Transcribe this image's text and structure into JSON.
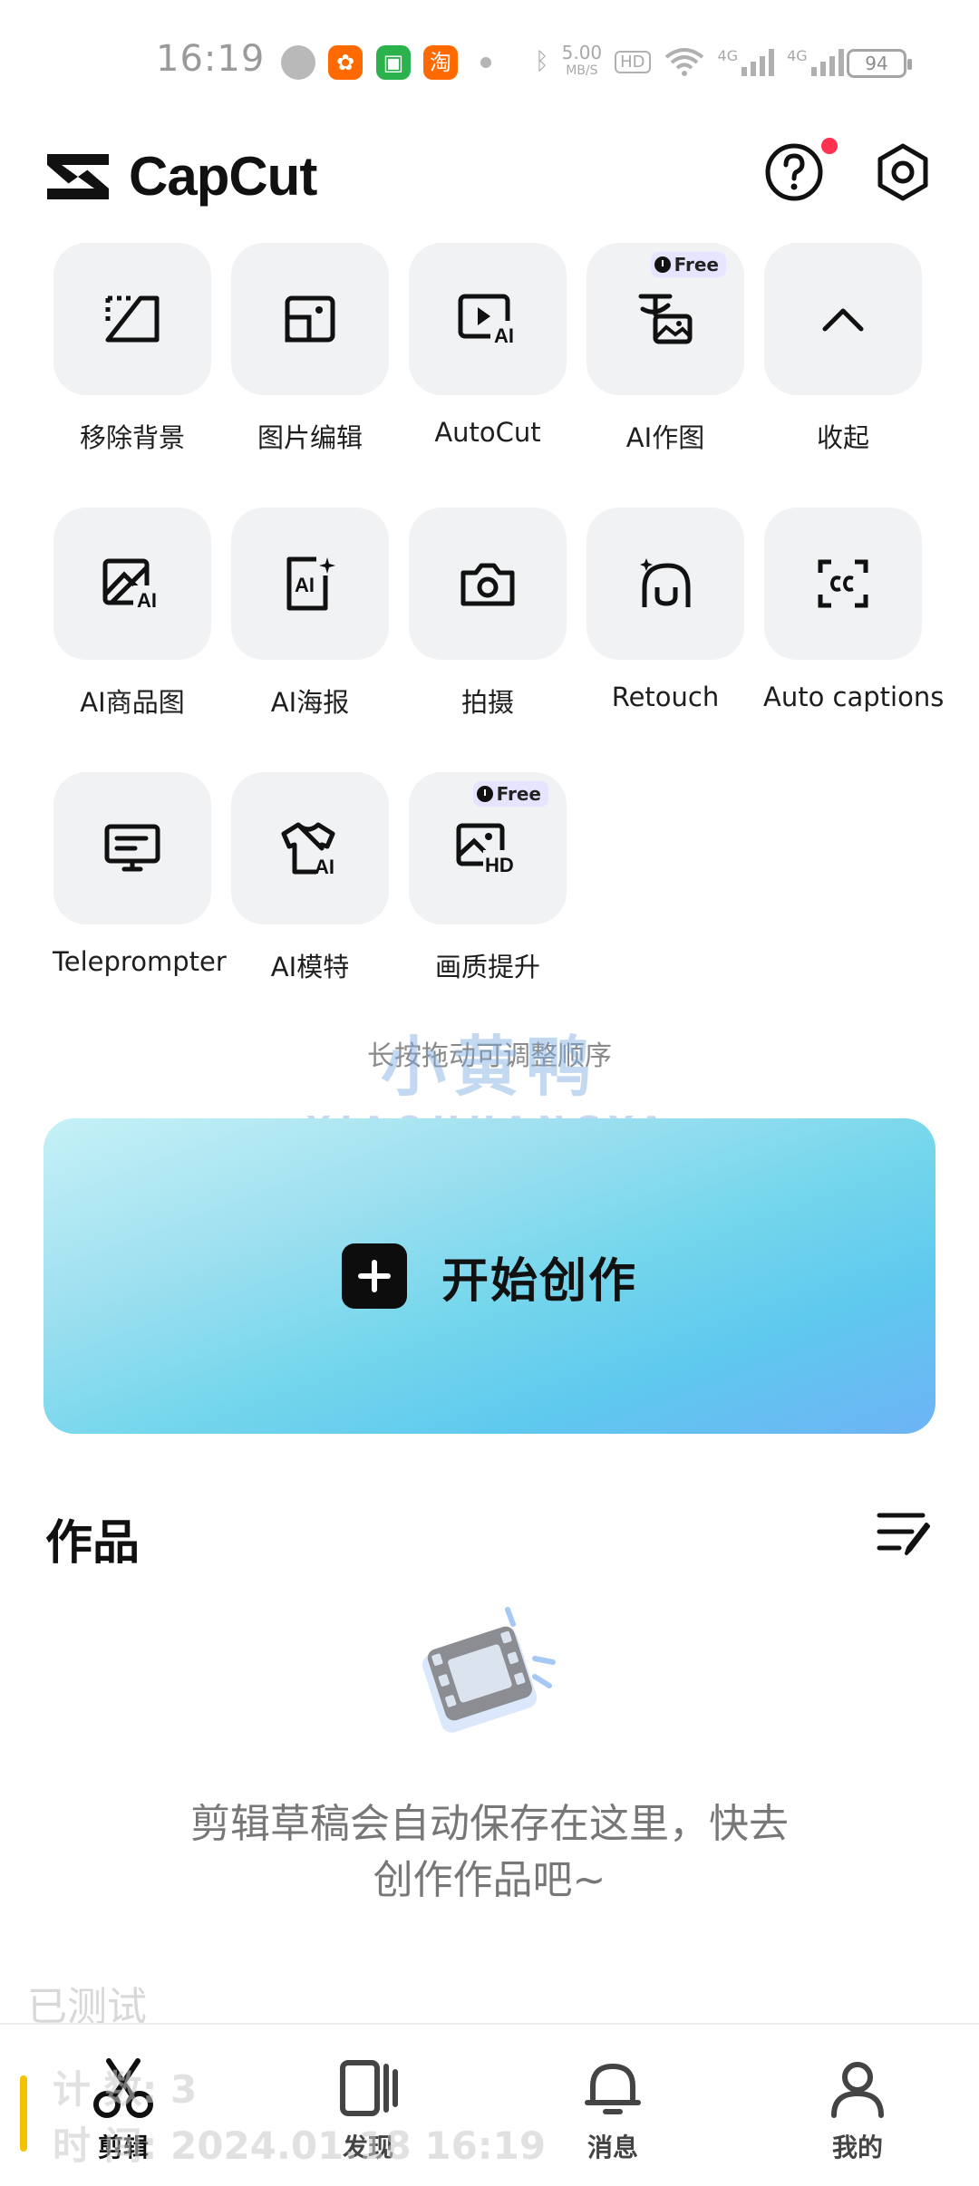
{
  "status_bar": {
    "time": "16:19",
    "network_speed_value": "5.00",
    "network_speed_unit": "MB/S",
    "hd_badge": "HD",
    "signal_1": "4G",
    "signal_2": "4G",
    "battery": "94"
  },
  "header": {
    "app_name": "CapCut",
    "help_icon": "help-circle-icon",
    "settings_icon": "settings-hexagon-icon",
    "help_has_notification": true
  },
  "tools": [
    {
      "label": "移除背景",
      "icon": "remove-background-icon",
      "free": false
    },
    {
      "label": "图片编辑",
      "icon": "photo-edit-icon",
      "free": false
    },
    {
      "label": "AutoCut",
      "icon": "autocut-icon",
      "free": false
    },
    {
      "label": "AI作图",
      "icon": "ai-image-icon",
      "free": true
    },
    {
      "label": "收起",
      "icon": "chevron-up-icon",
      "free": false
    },
    {
      "label": "AI商品图",
      "icon": "ai-product-icon",
      "free": false
    },
    {
      "label": "AI海报",
      "icon": "ai-poster-icon",
      "free": false
    },
    {
      "label": "拍摄",
      "icon": "camera-icon",
      "free": false
    },
    {
      "label": "Retouch",
      "icon": "retouch-icon",
      "free": false
    },
    {
      "label": "Auto captions",
      "icon": "captions-icon",
      "free": false
    },
    {
      "label": "Teleprompter",
      "icon": "teleprompter-icon",
      "free": false
    },
    {
      "label": "AI模特",
      "icon": "ai-model-shirt-icon",
      "free": false
    },
    {
      "label": "画质提升",
      "icon": "hd-enhance-icon",
      "free": true
    }
  ],
  "free_badge": "Free",
  "drag_hint": "长按拖动可调整顺序",
  "watermark": {
    "cn": "小黄鸭",
    "en": "XIAOHUANGYA"
  },
  "create_button": {
    "label": "开始创作"
  },
  "works": {
    "title": "作品",
    "empty_text_line1": "剪辑草稿会自动保存在这里，快去",
    "empty_text_line2": "创作作品吧~"
  },
  "overlay": {
    "tested": "已测试",
    "count": "计 数: 3",
    "time": "时 间: 2024.01.18 16:19"
  },
  "bottom_nav": [
    {
      "label": "剪辑",
      "icon": "scissors-icon",
      "active": true
    },
    {
      "label": "发现",
      "icon": "discover-video-icon",
      "active": false
    },
    {
      "label": "消息",
      "icon": "bell-icon",
      "active": false
    },
    {
      "label": "我的",
      "icon": "profile-icon",
      "active": false
    }
  ],
  "colors": {
    "accent": "#ff3050",
    "card_gradient_end": "#6db3f5",
    "badge": "#e6e4ff"
  }
}
